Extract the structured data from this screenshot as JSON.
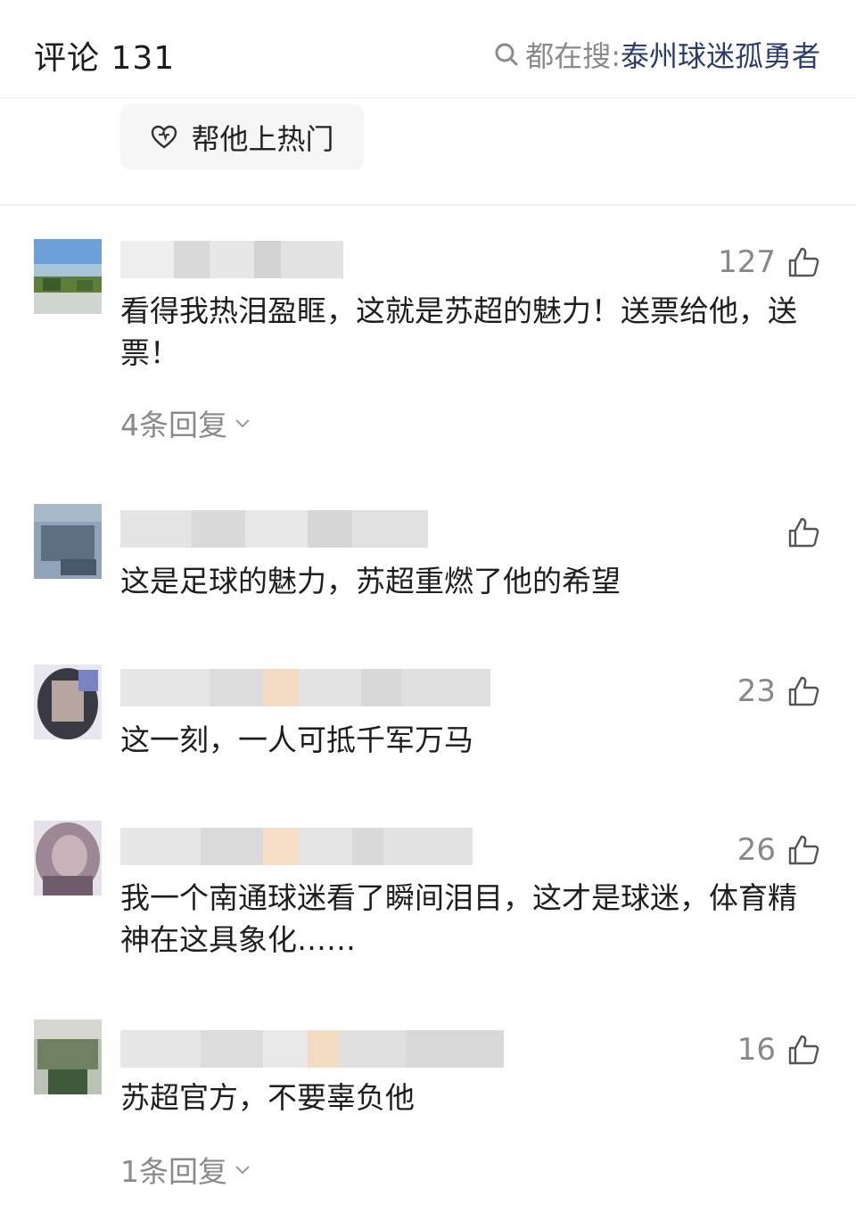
{
  "header": {
    "title": "评论 131",
    "search_prefix": "都在搜:",
    "search_term": "泰州球迷孤勇者",
    "search_icon": "search-icon"
  },
  "boost_button": {
    "label": "帮他上热门",
    "icon": "heart-icon"
  },
  "comments": [
    {
      "likes": "127",
      "text": "看得我热泪盈眶，这就是苏超的魅力！送票给他，送票！",
      "replies": "4条回复"
    },
    {
      "likes": "",
      "text": "这是足球的魅力，苏超重燃了他的希望",
      "replies": ""
    },
    {
      "likes": "23",
      "text": "这一刻，一人可抵千军万马",
      "replies": ""
    },
    {
      "likes": "26",
      "text": "我一个南通球迷看了瞬间泪目，这才是球迷，体育精神在这具象化……",
      "replies": ""
    },
    {
      "likes": "16",
      "text": "苏超官方，不要辜负他",
      "replies": "1条回复"
    }
  ],
  "icons": {
    "like": "thumbs-up-icon",
    "expand": "chevron-down-icon"
  },
  "colors": {
    "search_term": "#2b3e6b",
    "muted": "#8a8a8a"
  }
}
